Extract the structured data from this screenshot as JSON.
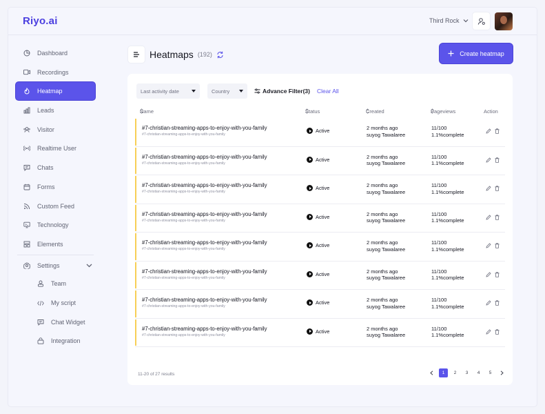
{
  "app": {
    "logo": "Riyo.ai",
    "workspace": "Third Rock"
  },
  "sidebar": {
    "items": [
      {
        "label": "Dashboard",
        "icon": "dashboard-icon",
        "active": false
      },
      {
        "label": "Recordings",
        "icon": "video-icon",
        "active": false
      },
      {
        "label": "Heatmap",
        "icon": "flame-icon",
        "active": true
      },
      {
        "label": "Leads",
        "icon": "bar-chart-icon",
        "active": false
      },
      {
        "label": "Visitor",
        "icon": "users-icon",
        "active": false
      },
      {
        "label": "Realtime User",
        "icon": "broadcast-icon",
        "active": false
      },
      {
        "label": "Chats",
        "icon": "chat-icon",
        "active": false
      },
      {
        "label": "Forms",
        "icon": "calendar-icon",
        "active": false
      },
      {
        "label": "Custom Feed",
        "icon": "rss-icon",
        "active": false
      },
      {
        "label": "Technology",
        "icon": "monitor-icon",
        "active": false
      },
      {
        "label": "Elements",
        "icon": "grid-icon",
        "active": false
      }
    ],
    "settings": {
      "label": "Settings",
      "icon": "gear-icon"
    },
    "subitems": [
      {
        "label": "Team",
        "icon": "team-icon"
      },
      {
        "label": "My script",
        "icon": "code-icon"
      },
      {
        "label": "Chat Widget",
        "icon": "message-icon"
      },
      {
        "label": "Integration",
        "icon": "lock-icon"
      }
    ]
  },
  "header": {
    "title": "Heatmaps",
    "count": "(192)",
    "create_label": "Create heatmap"
  },
  "filters": {
    "activity": "Last activity date",
    "country": "Country",
    "advanced": "Advance Filter(3)",
    "clear": "All"
  },
  "table": {
    "columns": {
      "name": "Name",
      "status": "Status",
      "created": "Created",
      "pageviews": "Pageviews",
      "action": "Action"
    },
    "rows": [
      {
        "name": "#7-christian-streaming-apps-to-enjoy-with-you-family",
        "slug": "#7-christian-streaming-apps-to-enjoy-with-you-family",
        "status": "Active",
        "created_ago": "2 months ago",
        "created_by": "suyog Tawalaree",
        "views": "11/100",
        "complete": "1.1%complete"
      },
      {
        "name": "#7-christian-streaming-apps-to-enjoy-with-you-family",
        "slug": "#7-christian-streaming-apps-to-enjoy-with-you-family",
        "status": "Active",
        "created_ago": "2 months ago",
        "created_by": "suyog Tawalaree",
        "views": "11/100",
        "complete": "1.1%complete"
      },
      {
        "name": "#7-christian-streaming-apps-to-enjoy-with-you-family",
        "slug": "#7-christian-streaming-apps-to-enjoy-with-you-family",
        "status": "Active",
        "created_ago": "2 months ago",
        "created_by": "suyog Tawalaree",
        "views": "11/100",
        "complete": "1.1%complete"
      },
      {
        "name": "#7-christian-streaming-apps-to-enjoy-with-you-family",
        "slug": "#7-christian-streaming-apps-to-enjoy-with-you-family",
        "status": "Active",
        "created_ago": "2 months ago",
        "created_by": "suyog Tawalaree",
        "views": "11/100",
        "complete": "1.1%complete"
      },
      {
        "name": "#7-christian-streaming-apps-to-enjoy-with-you-family",
        "slug": "#7-christian-streaming-apps-to-enjoy-with-you-family",
        "status": "Active",
        "created_ago": "2 months ago",
        "created_by": "suyog Tawalaree",
        "views": "11/100",
        "complete": "1.1%complete"
      },
      {
        "name": "#7-christian-streaming-apps-to-enjoy-with-you-family",
        "slug": "#7-christian-streaming-apps-to-enjoy-with-you-family",
        "status": "Active",
        "created_ago": "2 months ago",
        "created_by": "suyog Tawalaree",
        "views": "11/100",
        "complete": "1.1%complete"
      },
      {
        "name": "#7-christian-streaming-apps-to-enjoy-with-you-family",
        "slug": "#7-christian-streaming-apps-to-enjoy-with-you-family",
        "status": "Active",
        "created_ago": "2 months ago",
        "created_by": "suyog Tawalaree",
        "views": "11/100",
        "complete": "1.1%complete"
      },
      {
        "name": "#7-christian-streaming-apps-to-enjoy-with-you-family",
        "slug": "#7-christian-streaming-apps-to-enjoy-with-you-family",
        "status": "Active",
        "created_ago": "2 months ago",
        "created_by": "suyog Tawalaree",
        "views": "11/100",
        "complete": "1.1%complete"
      }
    ]
  },
  "footer": {
    "results": "11-20 of 27 results",
    "pages": [
      "1",
      "2",
      "3",
      "4",
      "5"
    ],
    "current_page": "1"
  },
  "colors": {
    "accent": "#5b54ea",
    "row_marker": "#f7cf55",
    "background": "#f5f6fd"
  }
}
